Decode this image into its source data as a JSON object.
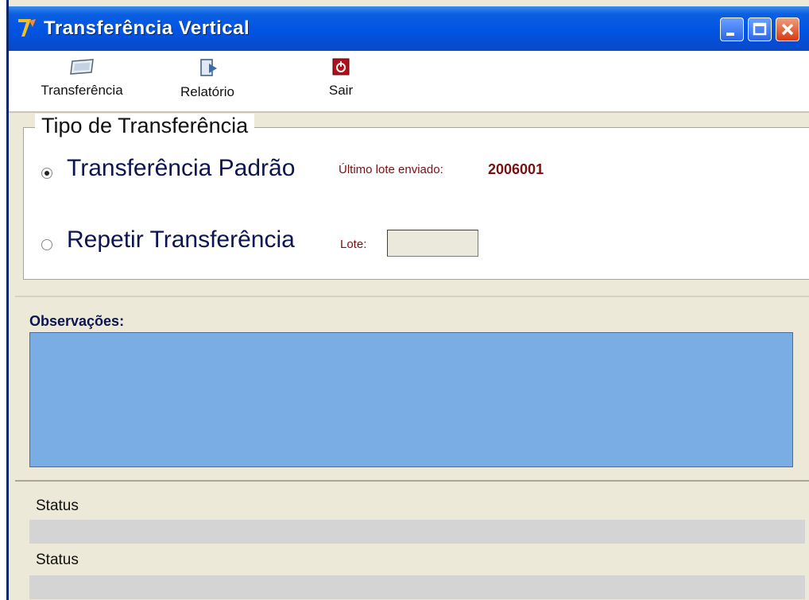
{
  "window": {
    "title": "Transferência Vertical",
    "icons": {
      "app": "app-logo-icon",
      "minimize": "minimize-icon",
      "maximize": "maximize-icon",
      "close": "close-icon"
    }
  },
  "toolbar": {
    "transfer_label": "Transferência",
    "transfer_icon": "transfer-icon",
    "report_label": "Relatório",
    "report_icon": "report-icon",
    "exit_label": "Sair",
    "exit_icon": "exit-icon"
  },
  "transfer_type": {
    "legend": "Tipo de Transferência",
    "standard_label": "Transferência Padrão",
    "standard_selected": true,
    "last_lot_label": "Último lote enviado:",
    "last_lot_value": "2006001",
    "repeat_label": "Repetir Transferência",
    "repeat_selected": false,
    "lot_label": "Lote:",
    "lot_value": ""
  },
  "observations": {
    "label": "Observações:",
    "value": ""
  },
  "status": [
    {
      "label": "Status",
      "value": ""
    },
    {
      "label": "Status",
      "value": ""
    }
  ],
  "colors": {
    "title_bar": "#0054e3",
    "observations_bg": "#7aade4",
    "lot_text": "#7a1014",
    "option_text": "#0d1550"
  }
}
